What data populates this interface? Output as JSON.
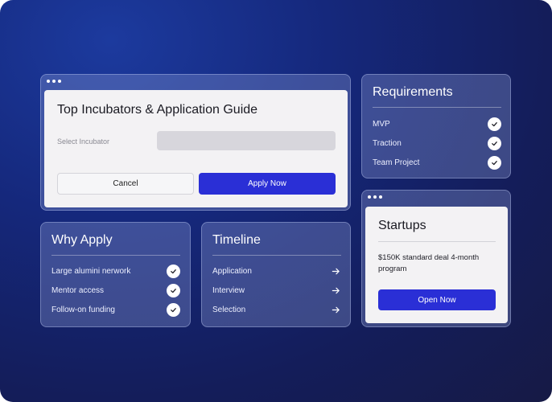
{
  "guide": {
    "title": "Top Incubators & Application Guide",
    "select_label": "Select Incubator",
    "select_value": "",
    "cancel_label": "Cancel",
    "apply_label": "Apply Now"
  },
  "requirements": {
    "title": "Requirements",
    "items": [
      {
        "label": "MVP",
        "icon": "check-icon"
      },
      {
        "label": "Traction",
        "icon": "check-icon"
      },
      {
        "label": "Team Project",
        "icon": "check-icon"
      }
    ]
  },
  "why_apply": {
    "title": "Why Apply",
    "items": [
      {
        "label": "Large alumini nerwork",
        "icon": "check-icon"
      },
      {
        "label": "Mentor access",
        "icon": "check-icon"
      },
      {
        "label": "Follow-on funding",
        "icon": "check-icon"
      }
    ]
  },
  "timeline": {
    "title": "Timeline",
    "items": [
      {
        "label": "Application",
        "icon": "arrow-right-icon"
      },
      {
        "label": "Interview",
        "icon": "arrow-right-icon"
      },
      {
        "label": "Selection",
        "icon": "arrow-right-icon"
      }
    ]
  },
  "startups": {
    "title": "Startups",
    "description": "$150K standard deal 4-month program",
    "button_label": "Open Now"
  },
  "colors": {
    "accent": "#2a2fd6",
    "background": "#15287c",
    "card": "#f3f2f4"
  }
}
